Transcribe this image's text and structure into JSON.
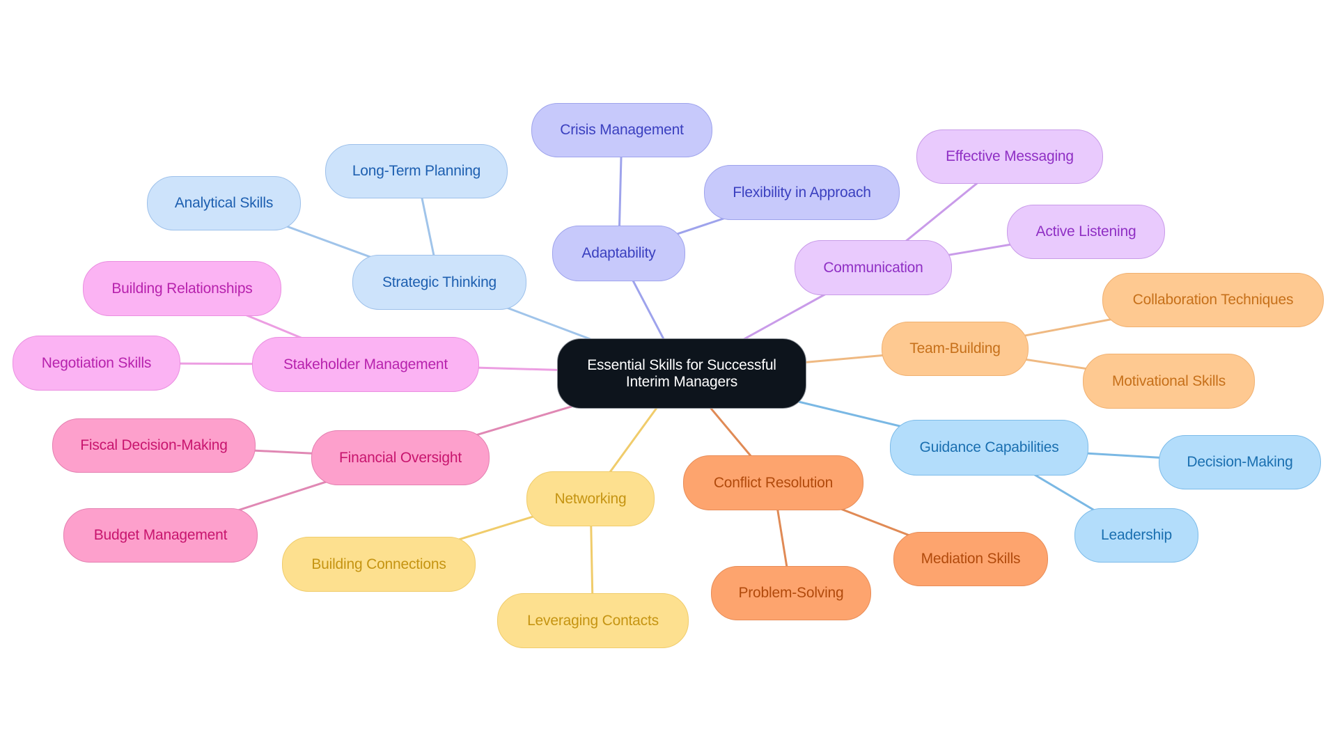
{
  "mindmap": {
    "root": {
      "id": "root",
      "label": "Essential Skills for Successful Interim Managers"
    },
    "branches": [
      {
        "id": "strategic",
        "label": "Strategic Thinking",
        "edge_color": "#a0c4ea",
        "children": [
          {
            "id": "longterm",
            "label": "Long-Term Planning"
          },
          {
            "id": "analytical",
            "label": "Analytical Skills"
          }
        ]
      },
      {
        "id": "adapt",
        "label": "Adaptability",
        "edge_color": "#9ea3ec",
        "children": [
          {
            "id": "crisis",
            "label": "Crisis Management"
          },
          {
            "id": "flex",
            "label": "Flexibility in Approach"
          }
        ]
      },
      {
        "id": "comm",
        "label": "Communication",
        "edge_color": "#c99be9",
        "children": [
          {
            "id": "messaging",
            "label": "Effective Messaging"
          },
          {
            "id": "listening",
            "label": "Active Listening"
          }
        ]
      },
      {
        "id": "team",
        "label": "Team-Building",
        "edge_color": "#efb982",
        "children": [
          {
            "id": "collab",
            "label": "Collaboration Techniques"
          },
          {
            "id": "motiv",
            "label": "Motivational Skills"
          }
        ]
      },
      {
        "id": "guide",
        "label": "Guidance Capabilities",
        "edge_color": "#7ab8e4",
        "children": [
          {
            "id": "decision",
            "label": "Decision-Making"
          },
          {
            "id": "leader",
            "label": "Leadership"
          }
        ]
      },
      {
        "id": "conflict",
        "label": "Conflict Resolution",
        "edge_color": "#e08a55",
        "children": [
          {
            "id": "mediation",
            "label": "Mediation Skills"
          },
          {
            "id": "problem",
            "label": "Problem-Solving"
          }
        ]
      },
      {
        "id": "network",
        "label": "Networking",
        "edge_color": "#f0cc6b",
        "children": [
          {
            "id": "buildconn",
            "label": "Building Connections"
          },
          {
            "id": "leverage",
            "label": "Leveraging Contacts"
          }
        ]
      },
      {
        "id": "finance",
        "label": "Financial Oversight",
        "edge_color": "#e088b4",
        "children": [
          {
            "id": "fiscal",
            "label": "Fiscal Decision-Making"
          },
          {
            "id": "budget",
            "label": "Budget Management"
          }
        ]
      },
      {
        "id": "stake",
        "label": "Stakeholder Management",
        "edge_color": "#ec9ee2",
        "children": [
          {
            "id": "relations",
            "label": "Building Relationships"
          },
          {
            "id": "negotiation",
            "label": "Negotiation Skills"
          }
        ]
      }
    ]
  }
}
